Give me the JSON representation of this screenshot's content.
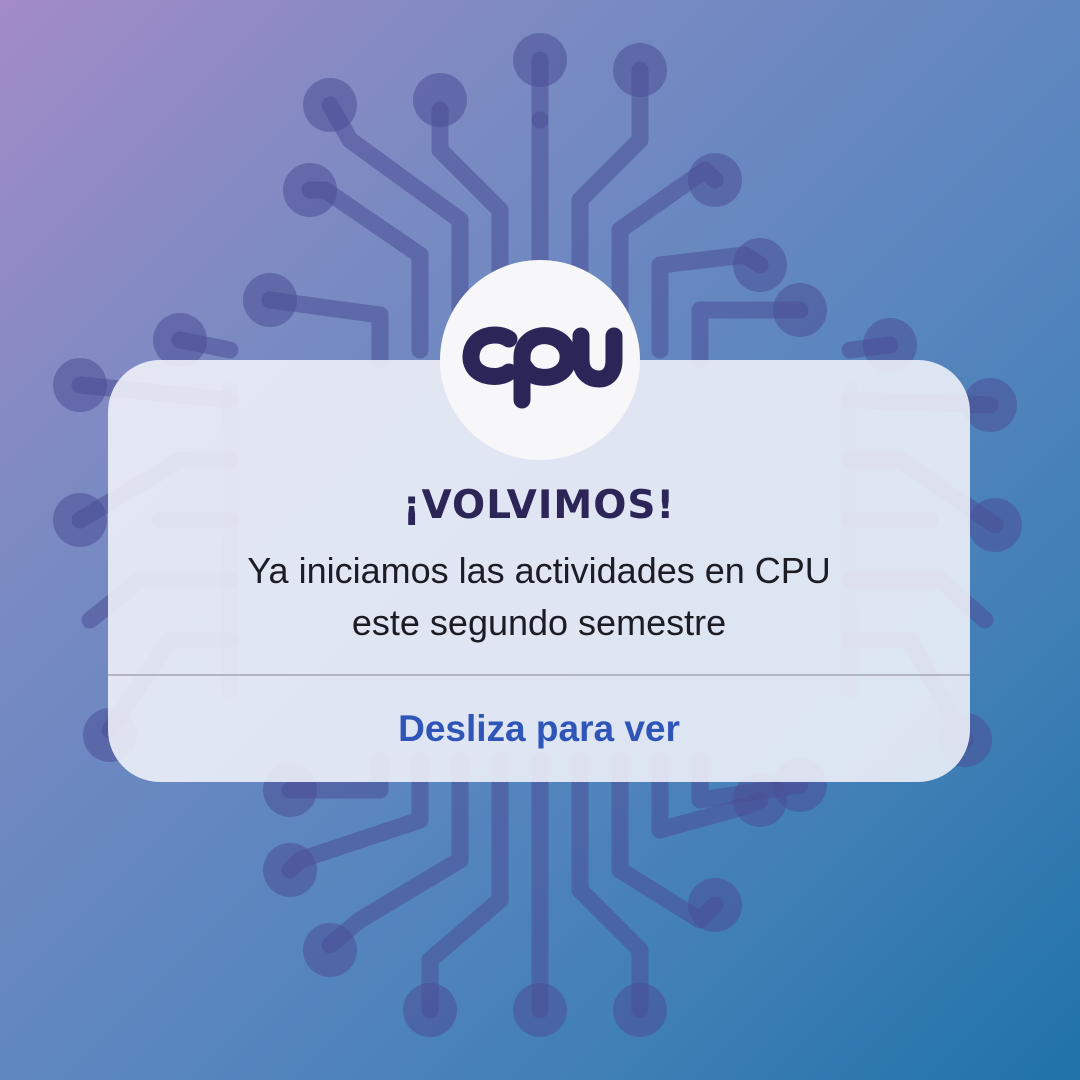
{
  "brand": {
    "logo_icon": "cpu-logo-icon",
    "logo_text": "cpu"
  },
  "post": {
    "headline": "¡VOLVIMOS!",
    "body_line_1": "Ya iniciamos las actividades en CPU",
    "body_line_2": "este segundo semestre",
    "swipe_label": "Desliza para ver"
  },
  "colors": {
    "background_start": "#a28bc8",
    "background_end": "#1f72a8",
    "circuit": "#4a4f95",
    "card": "#f1f3f9",
    "brand_navy": "#2b2558",
    "link_blue": "#2f55b8",
    "divider": "#b4b6bf"
  },
  "icons": {
    "background": "circuit-board-icon"
  }
}
